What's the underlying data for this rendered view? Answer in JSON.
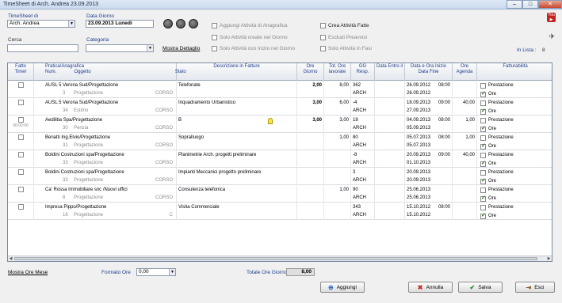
{
  "window": {
    "title": "TimeSheet di Arch. Andrea 23.09.2013",
    "minimize": "–",
    "maximize": "□",
    "close": "✕"
  },
  "filters": {
    "timesheet_label": "TimeSheet di",
    "timesheet_value": "Arch. Andrea",
    "data_giorno_label": "Data Giorno",
    "data_giorno_value": "23.09.2013 Lunedì",
    "cerca_label": "Cerca",
    "cerca_value": "",
    "categoria_label": "Categoria",
    "categoria_value": "",
    "mostra_dettaglio": "Mostra Dettaglio",
    "in_lista_label": "In Lista :",
    "in_lista_value": "8"
  },
  "options": {
    "aggiungi_anagrafica": "Aggiungi Attività di Anagrafica",
    "solo_create_giorno": "Solo Attività create nel Giorno",
    "solo_inizio_giorno": "Solo Attività con Inizio nel Giorno",
    "crea_attivita_fatte": "Crea Attività Fatte",
    "escludi_preavvisi": "Escludi Preavvisi",
    "solo_in_fasi": "Solo Attività in Fasi"
  },
  "columns": {
    "fatto": "Fatto",
    "timer": "Timer",
    "pratica": "Pratica/Anagrafica",
    "num": "Num.",
    "oggetto": "Oggetto",
    "stato": "Stato",
    "descrizione": "Descrizione in Fatture",
    "ore_giorno_1": "Ore",
    "ore_giorno_2": "Giorno",
    "tot_ore_1": "Tot. Ore",
    "tot_ore_2": "lavorate",
    "gg_1": "GG",
    "gg_2": "Resp.",
    "data_entro": "Data Entro il",
    "data_inizio": "Data e Ora Inizio",
    "data_fine": "Data Fine",
    "ore_agenda_1": "Ore",
    "ore_agenda_2": "Agenda",
    "fatturabilita": "Fatturabilità"
  },
  "rows": [
    {
      "timer": "",
      "pratica": "AUSL 5 Verona Sud/Progettazione",
      "num": "3",
      "oggetto": "Progettazione",
      "stato": "CORSO",
      "descrizione": "Telefonate",
      "ore_giorno": "2,00",
      "tot_ore": "8,00",
      "gg": "362",
      "resp": "ARCH",
      "data_inizio": "26.09.2012",
      "ora_inizio": "08:00",
      "data_fine": "26.09.2012",
      "ore_agenda": "",
      "prestazione": "Prestazione",
      "ore_lbl": "Ore",
      "ore_checked": true
    },
    {
      "timer": "",
      "pratica": "AUSL 5 Verona Sud/Progettazione",
      "num": "34",
      "oggetto": "Estimo",
      "stato": "CORSO",
      "descrizione": "Inquadramento Urbanistico",
      "ore_giorno": "3,00",
      "tot_ore": "6,00",
      "gg": "-4",
      "resp": "ARCH",
      "data_inizio": "18.09.2013",
      "ora_inizio": "09:00",
      "data_fine": "27.09.2013",
      "ore_agenda": "40,00",
      "prestazione": "Prestazione",
      "ore_lbl": "Ore",
      "ore_checked": true
    },
    {
      "timer": "00:00:00",
      "pratica": "Aedilitia Spa/Progettazione",
      "num": "30",
      "oggetto": "Perizia",
      "stato": "CORSO",
      "descrizione": "B",
      "ore_giorno": "3,00",
      "tot_ore": "3,00",
      "gg": "18",
      "resp": "ARCH",
      "data_inizio": "04.09.2013",
      "ora_inizio": "08:00",
      "data_fine": "05.09.2013",
      "ore_agenda": "1,00",
      "prestazione": "Prestazione",
      "ore_lbl": "Ore",
      "ore_checked": true
    },
    {
      "timer": "",
      "pratica": "Benatti Ing.Elvio/Progettazione",
      "num": "31",
      "oggetto": "Progettazione",
      "stato": "CORSO",
      "descrizione": "Sopralluogo",
      "ore_giorno": "",
      "tot_ore": "1,00",
      "gg": "80",
      "resp": "ARCH",
      "data_inizio": "05.07.2013",
      "ora_inizio": "08:00",
      "data_fine": "05.07.2013",
      "ore_agenda": "1,00",
      "prestazione": "Prestazione",
      "ore_lbl": "Ore",
      "ore_checked": true
    },
    {
      "timer": "",
      "pratica": "Boldini Costruzioni spa/Progettazione",
      "num": "33",
      "oggetto": "Progettazione",
      "stato": "CORSO",
      "descrizione": "Planimetrie Arch. progetti preliminare",
      "ore_giorno": "",
      "tot_ore": "",
      "gg": "-8",
      "resp": "ARCH",
      "data_inizio": "20.09.2013",
      "ora_inizio": "09:00",
      "data_fine": "01.10.2013",
      "ore_agenda": "40,00",
      "prestazione": "Prestazione",
      "ore_lbl": "Ore",
      "ore_checked": true
    },
    {
      "timer": "",
      "pratica": "Boldini Costruzioni spa/Progettazione",
      "num": "33",
      "oggetto": "Progettazione",
      "stato": "CORSO",
      "descrizione": "Impianti Meccanici progetto preliminare",
      "ore_giorno": "",
      "tot_ore": "",
      "gg": "3",
      "resp": "ARCH",
      "data_inizio": "20.09.2013",
      "ora_inizio": "",
      "data_fine": "20.09.2013",
      "ore_agenda": "",
      "prestazione": "Prestazione",
      "ore_lbl": "Ore",
      "ore_checked": true
    },
    {
      "timer": "",
      "pratica": "Ca' Rossa Immobiliare snc /Nuovi uffici",
      "num": "6",
      "oggetto": "Progettazione",
      "stato": "CORSO",
      "descrizione": "Consulenza telefonica",
      "ore_giorno": "",
      "tot_ore": "1,00",
      "gg": "90",
      "resp": "ARCH",
      "data_inizio": "25.06.2013",
      "ora_inizio": "",
      "data_fine": "25.06.2013",
      "ore_agenda": "",
      "prestazione": "Prestazione",
      "ore_lbl": "Ore",
      "ore_checked": true
    },
    {
      "timer": "",
      "pratica": "Impresa Pippo/Progettazione",
      "num": "16",
      "oggetto": "Progettazione",
      "stato": "C",
      "descrizione": "Visita Commerciale",
      "ore_giorno": "",
      "tot_ore": "",
      "gg": "343",
      "resp": "ARCH",
      "data_inizio": "15.10.2012",
      "ora_inizio": "08:00",
      "data_fine": "15.10.2012",
      "ore_agenda": "",
      "prestazione": "Prestazione",
      "ore_lbl": "Ore",
      "ore_checked": true
    }
  ],
  "footer": {
    "mostra_ore_mese": "Mostra Ore Mese",
    "formato_ore_label": "Formato Ore",
    "formato_ore_value": "0,00",
    "totale_ore_label": "Totale Ore Giorno",
    "totale_ore_value": "8,00",
    "aggiungi": "Aggiungi",
    "annulla": "Annulla",
    "salva": "Salva",
    "esci": "Esci"
  }
}
